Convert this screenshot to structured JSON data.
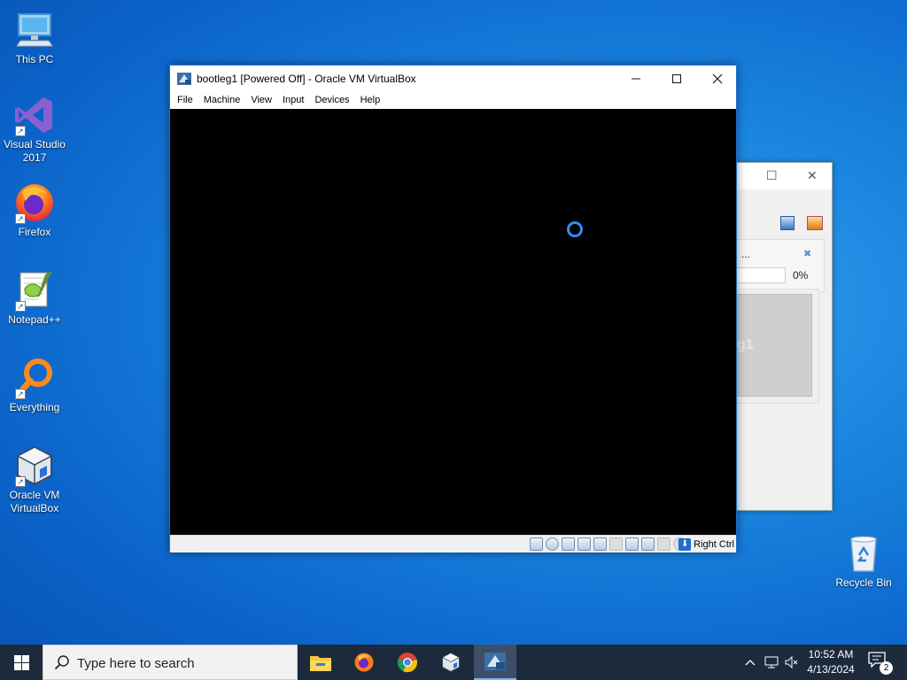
{
  "desktop": {
    "icons": [
      {
        "label": "This PC"
      },
      {
        "label": "Visual Studio 2017"
      },
      {
        "label": "Firefox"
      },
      {
        "label": "Notepad++"
      },
      {
        "label": "Everything"
      },
      {
        "label": "Oracle VM VirtualBox"
      },
      {
        "label": "Recycle Bin"
      }
    ]
  },
  "background_window": {
    "status_text": "...",
    "progress_text": "0%",
    "preview_text": "g1"
  },
  "vbox_window": {
    "title": "bootleg1 [Powered Off] - Oracle VM VirtualBox",
    "menu": [
      "File",
      "Machine",
      "View",
      "Input",
      "Devices",
      "Help"
    ],
    "host_key": "Right Ctrl"
  },
  "taskbar": {
    "search_placeholder": "Type here to search",
    "apps": [
      "file-explorer",
      "firefox",
      "chrome",
      "virtualbox",
      "virtualbox-vm"
    ],
    "clock_time": "10:52 AM",
    "clock_date": "4/13/2024",
    "notification_count": "2"
  },
  "colors": {
    "accent": "#1e70c8",
    "taskbar": "#1c2a3c",
    "spinner": "#2e8ef0"
  }
}
